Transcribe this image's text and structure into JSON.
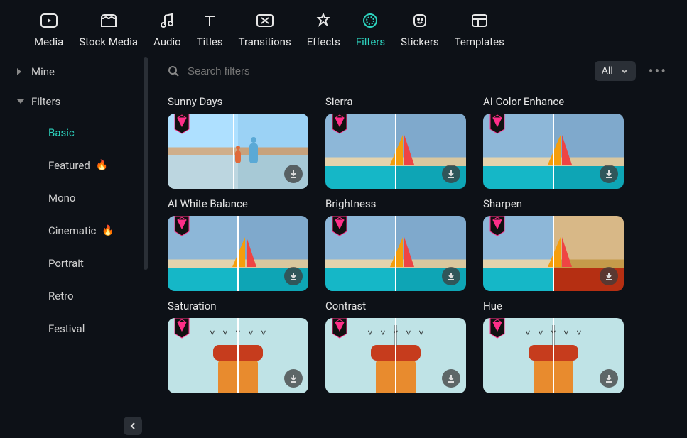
{
  "topnav": {
    "items": [
      {
        "label": "Media",
        "icon": "media"
      },
      {
        "label": "Stock Media",
        "icon": "stock"
      },
      {
        "label": "Audio",
        "icon": "audio"
      },
      {
        "label": "Titles",
        "icon": "titles"
      },
      {
        "label": "Transitions",
        "icon": "transitions"
      },
      {
        "label": "Effects",
        "icon": "effects"
      },
      {
        "label": "Filters",
        "icon": "filters",
        "active": true
      },
      {
        "label": "Stickers",
        "icon": "stickers"
      },
      {
        "label": "Templates",
        "icon": "templates"
      }
    ]
  },
  "sidebar": {
    "sections": [
      {
        "label": "Mine",
        "open": false
      },
      {
        "label": "Filters",
        "open": true
      }
    ],
    "subitems": [
      {
        "label": "Basic",
        "active": true
      },
      {
        "label": "Featured",
        "hot": true
      },
      {
        "label": "Mono"
      },
      {
        "label": "Cinematic",
        "hot": true
      },
      {
        "label": "Portrait"
      },
      {
        "label": "Retro"
      },
      {
        "label": "Festival"
      }
    ]
  },
  "search": {
    "placeholder": "Search filters"
  },
  "dropdown": {
    "label": "All"
  },
  "grid": {
    "items": [
      {
        "label": "Sunny Days",
        "art": "beach",
        "split_left": true
      },
      {
        "label": "Sierra",
        "art": "sail"
      },
      {
        "label": "AI Color Enhance",
        "art": "sail"
      },
      {
        "label": "AI White Balance",
        "art": "sail"
      },
      {
        "label": "Brightness",
        "art": "sail"
      },
      {
        "label": "Sharpen",
        "art": "sail",
        "warm": true
      },
      {
        "label": "Saturation",
        "art": "tower"
      },
      {
        "label": "Contrast",
        "art": "tower"
      },
      {
        "label": "Hue",
        "art": "tower"
      }
    ]
  }
}
